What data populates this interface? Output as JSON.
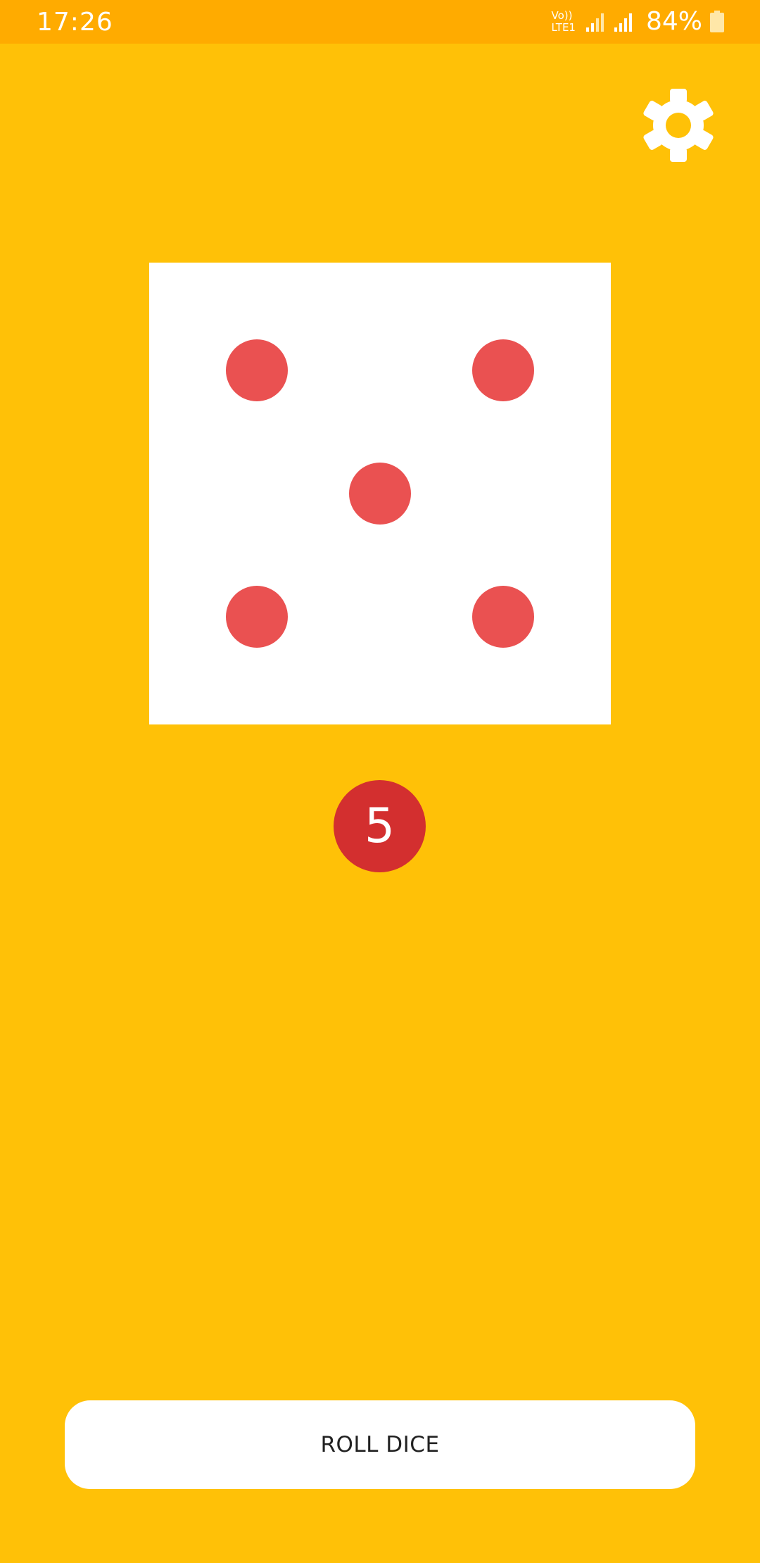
{
  "status_bar": {
    "time": "17:26",
    "network_line1": "Vo))",
    "network_line2": "LTE1",
    "battery_text": "84%",
    "icons": [
      "volte-icon",
      "signal-icon",
      "signal-icon",
      "battery-icon"
    ]
  },
  "toolbar": {
    "settings_icon": "gear-icon"
  },
  "die": {
    "face_value": 5,
    "pip_color": "#EA5151",
    "face_color": "#FFFFFF"
  },
  "result": {
    "value": "5",
    "badge_color": "#D32F2F"
  },
  "actions": {
    "roll_label": "ROLL DICE"
  },
  "colors": {
    "background": "#FFC107",
    "status_bar": "#FFAB00"
  }
}
